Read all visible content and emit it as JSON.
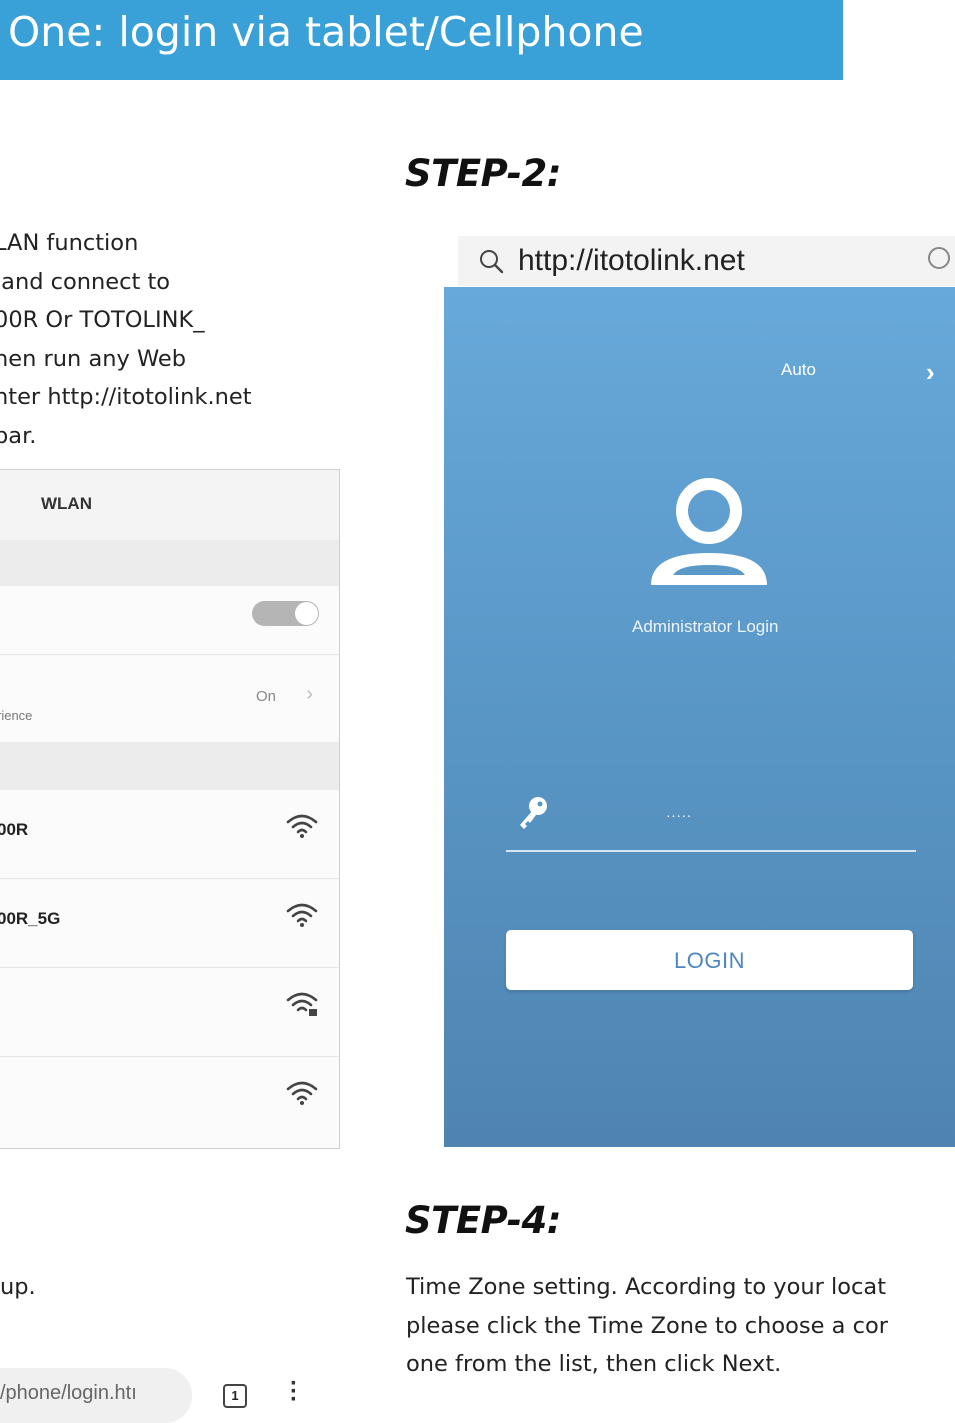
{
  "header": {
    "title": "One: login via tablet/Cellphone"
  },
  "step2": {
    "title": "STEP-2:"
  },
  "step4": {
    "title": "STEP-4:",
    "text": "Time Zone setting. According to your locat\nplease click the Time Zone to choose a cor\none from the list, then click Next."
  },
  "step1": {
    "text": "LAN function\n and connect to\n00R Or TOTOLINK_\nhen run any Web\nnter http://itotolink.net\nbar."
  },
  "step3": {
    "text": "up."
  },
  "wlan_screenshot": {
    "title": "WLAN",
    "toggle_on": true,
    "assist_value": "On",
    "assist_label_fragment": "rience",
    "networks": [
      {
        "name": "00R",
        "icon": "wifi-icon"
      },
      {
        "name": "00R_5G",
        "icon": "wifi-icon"
      },
      {
        "name": "",
        "icon": "wifi-locked-icon"
      },
      {
        "name": "",
        "icon": "wifi-icon"
      }
    ]
  },
  "url_bar": {
    "url": "http://itotolink.net"
  },
  "login_screenshot": {
    "language": "Auto",
    "admin_label": "Administrator Login",
    "password_mask": "·····",
    "login_label": "LOGIN",
    "colors": {
      "gradient_top": "#67a9da",
      "gradient_bottom": "#4f84b0",
      "button_text": "#4e86c0"
    }
  },
  "browser_bar": {
    "address": "/phone/login.htı",
    "tab_count": "1"
  },
  "colors": {
    "header_bg": "#3aa0d8"
  }
}
